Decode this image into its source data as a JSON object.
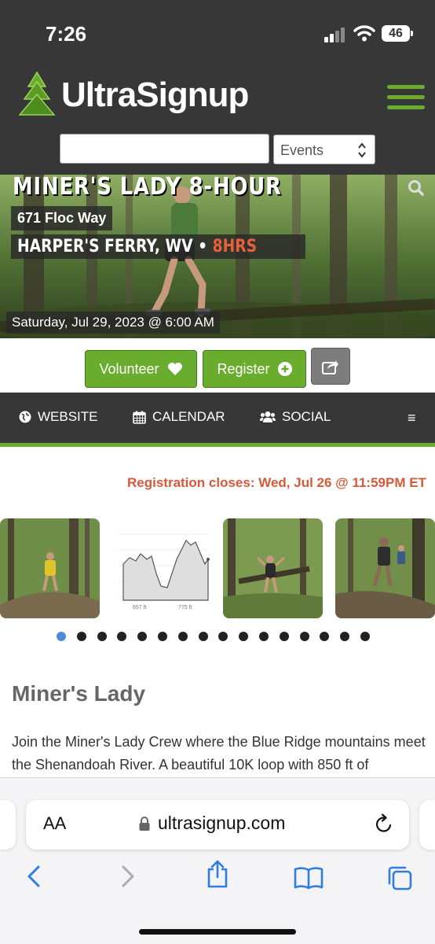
{
  "status_bar": {
    "time": "7:26",
    "battery": "46"
  },
  "header": {
    "brand": "UltraSignup",
    "search_value": "",
    "search_placeholder": "",
    "filter_selected": "Events",
    "accent_color": "#6aac2e"
  },
  "hero": {
    "title": "MINER'S LADY 8-HOUR",
    "address": "671 Floc Way",
    "location": "HARPER'S FERRY, WV",
    "separator": "•",
    "duration": "8HRS",
    "date": "Saturday, Jul 29, 2023 @ 6:00 AM"
  },
  "actions": {
    "volunteer": "Volunteer",
    "register": "Register"
  },
  "nav": {
    "website": "WEBSITE",
    "calendar": "CALENDAR",
    "social": "SOCIAL",
    "menu": "≡"
  },
  "registration": {
    "closes": "Registration closes: Wed, Jul 26 @ 11:59PM ET",
    "color": "#d9583a"
  },
  "carousel": {
    "elevation_labels": {
      "left": "657 ft",
      "right": "775 ft"
    },
    "dot_count": 16,
    "active_index": 0
  },
  "event": {
    "name": "Miner's Lady",
    "description": "Join the Miner's Lady Crew where the Blue Ridge mountains meet the Shenandoah River. A beautiful 10K loop with 850 ft of elevation gain meandering through the mountains, mostly"
  },
  "browser": {
    "text_size_label": "AA",
    "url": "ultrasignup.com"
  }
}
